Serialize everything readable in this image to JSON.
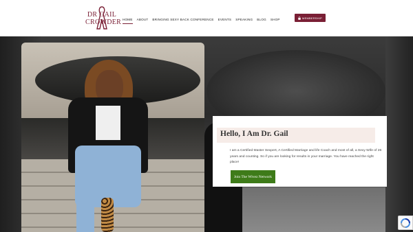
{
  "header": {
    "logo": {
      "line1": "DR GAIL",
      "line2": "CROWDER"
    },
    "nav": [
      {
        "label": "HOME",
        "active": true
      },
      {
        "label": "ABOUT",
        "active": false
      },
      {
        "label": "BRINGING SEXY BACK CONFERENCE",
        "active": false
      },
      {
        "label": "EVENTS",
        "active": false
      },
      {
        "label": "SPEAKING",
        "active": false
      },
      {
        "label": "BLOG",
        "active": false
      },
      {
        "label": "SHOP",
        "active": false
      }
    ],
    "membership_label": "MEMBERSHIP",
    "membership_icon": "lock-icon"
  },
  "intro": {
    "title": "Hello, I Am Dr. Gail",
    "body": "I am a Certified Master Sexpert, A Certified Marriage and life Coach and most of all, a Sexy Wife of 26 years and counting. So if you are looking for results in your marriage. You have reached the right place!",
    "button_label": "Join The Wivez Network"
  },
  "colors": {
    "brand": "#7a1f35",
    "button_green": "#3e7b19",
    "title_highlight": "#f6ece8"
  },
  "recaptcha_icon": "recaptcha-icon"
}
